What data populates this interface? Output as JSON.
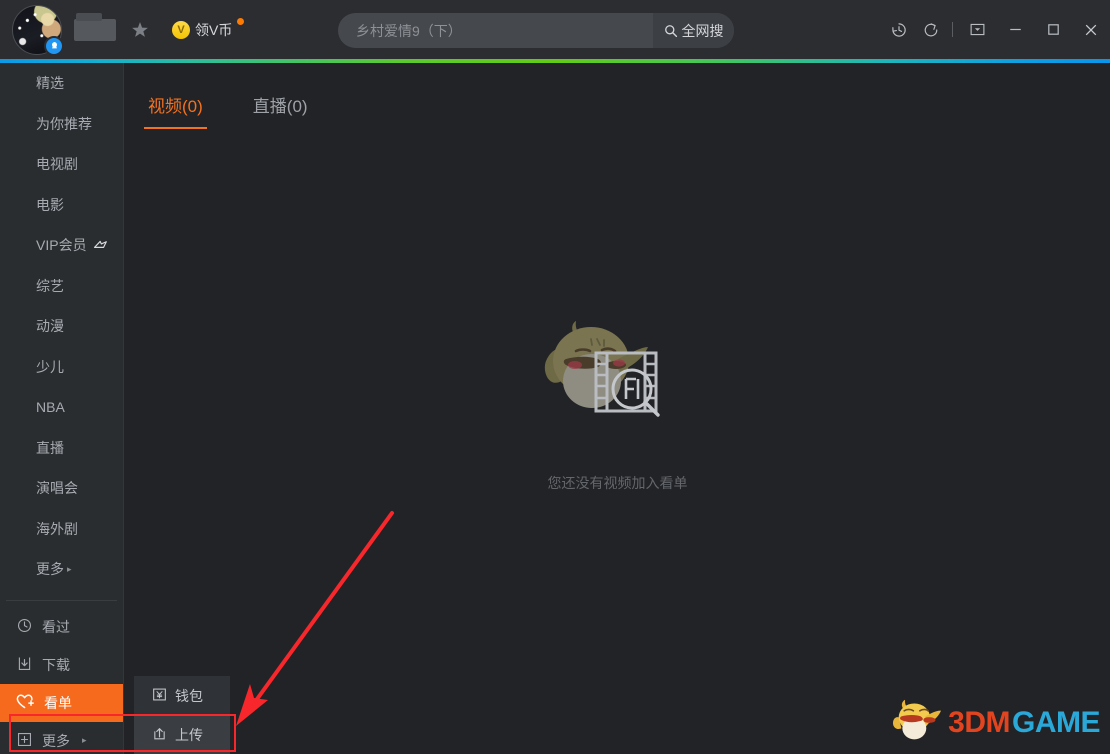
{
  "titlebar": {
    "avatar_name": "user-avatar",
    "username_redacted": "",
    "star_icon": "star-icon",
    "vcoin": {
      "symbol": "V",
      "label": "领V币",
      "has_badge": true
    },
    "search": {
      "placeholder": "乡村爱情9（下）",
      "value": "",
      "button_label": "全网搜",
      "button_icon": "search-icon"
    },
    "controls": [
      {
        "name": "history-icon",
        "tooltip": "历史"
      },
      {
        "name": "refresh-icon",
        "tooltip": "刷新"
      },
      {
        "name": "tray-icon",
        "tooltip": "最小化到托盘"
      },
      {
        "name": "minimize-icon",
        "tooltip": "最小化"
      },
      {
        "name": "maximize-icon",
        "tooltip": "最大化"
      },
      {
        "name": "close-icon",
        "tooltip": "关闭"
      }
    ]
  },
  "sidebar": {
    "nav": [
      {
        "label": "精选",
        "key": "jingxuan"
      },
      {
        "label": "为你推荐",
        "key": "weinituijian"
      },
      {
        "label": "电视剧",
        "key": "dianshiju"
      },
      {
        "label": "电影",
        "key": "dianying"
      },
      {
        "label": "VIP会员",
        "key": "vip",
        "badge": "vip-crown-icon"
      },
      {
        "label": "综艺",
        "key": "zongyi"
      },
      {
        "label": "动漫",
        "key": "dongman"
      },
      {
        "label": "少儿",
        "key": "shaoer"
      },
      {
        "label": "NBA",
        "key": "nba"
      },
      {
        "label": "直播",
        "key": "zhibo"
      },
      {
        "label": "演唱会",
        "key": "yanchanghui"
      },
      {
        "label": "海外剧",
        "key": "haiwaiju"
      },
      {
        "label": "更多",
        "key": "gengduo-top",
        "caret": "▸"
      }
    ],
    "tools": [
      {
        "label": "看过",
        "key": "kanguo",
        "icon": "history-clock-icon",
        "active": false
      },
      {
        "label": "下载",
        "key": "xiazai",
        "icon": "download-icon",
        "active": false
      },
      {
        "label": "看单",
        "key": "kandan",
        "icon": "heart-plus-icon",
        "active": true
      },
      {
        "label": "更多",
        "key": "gengduo",
        "icon": "plus-box-icon",
        "active": false,
        "caret": "▸",
        "outlined": true
      }
    ]
  },
  "flyout": {
    "items": [
      {
        "label": "钱包",
        "key": "qianbao",
        "icon": "wallet-icon",
        "highlight": false
      },
      {
        "label": "上传",
        "key": "shangchuan",
        "icon": "upload-icon",
        "highlight": true
      }
    ]
  },
  "content": {
    "tabs": [
      {
        "label": "视频(0)",
        "key": "video",
        "active": true
      },
      {
        "label": "直播(0)",
        "key": "live",
        "active": false
      }
    ],
    "empty": {
      "text": "您还没有视频加入看单",
      "graphic": "duck-filmstrip-search-icon"
    }
  },
  "watermark": {
    "mascot": "yellow-bird-icon",
    "text_primary": "3DM",
    "text_secondary": "GAME"
  },
  "annotation": {
    "box_label": "highlight-rectangle",
    "arrow_label": "red-pointer-arrow",
    "color": "#f8272b"
  },
  "colors": {
    "accent_orange": "#f66a1d",
    "tab_orange": "#f4711f",
    "titlebar_bg": "#2b2d31",
    "sidebar_bg": "#2a2d30",
    "content_bg": "#222326",
    "annotation_red": "#f8272b"
  }
}
